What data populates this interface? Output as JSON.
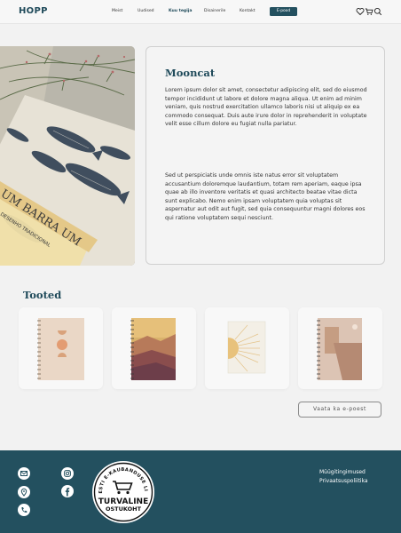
{
  "header": {
    "logo": "HOPP",
    "nav": [
      {
        "label": "Meist"
      },
      {
        "label": "Uudised"
      },
      {
        "label": "Kuu tegija"
      },
      {
        "label": "Disainerile"
      },
      {
        "label": "Kontakt"
      }
    ],
    "active_nav": "Kuu tegija",
    "eshop_label": "E-pood",
    "icons": [
      "heart-icon",
      "cart-icon",
      "search-icon"
    ]
  },
  "hero": {
    "image_alt": "sketchbooks-with-fish-illustration",
    "card_title": "Mooncat",
    "paragraph1": "Lorem ipsum dolor sit amet, consectetur adipiscing elit, sed do eiusmod tempor incididunt ut labore et dolore magna aliqua. Ut enim ad minim veniam, quis nostrud exercitation ullamco laboris nisi ut aliquip ex ea commodo consequat. Duis aute irure dolor in reprehenderit in voluptate velit esse cillum dolore eu fugiat nulla pariatur.",
    "paragraph2": "Sed ut perspiciatis unde omnis iste natus error sit voluptatem accusantium doloremque laudantium, totam rem aperiam, eaque ipsa quae ab illo inventore veritatis et quasi architecto beatae vitae dicta sunt explicabo. Nemo enim ipsam voluptatem quia voluptas sit aspernatur aut odit aut fugit, sed quia consequuntur magni dolores eos qui ratione voluptatem sequi nesciunt."
  },
  "products": {
    "title": "Tooted",
    "items": [
      {
        "name": "notebook-moon-phases"
      },
      {
        "name": "notebook-desert-sunset"
      },
      {
        "name": "notebook-sun-rays"
      },
      {
        "name": "notebook-abstract-shapes"
      }
    ],
    "more_button": "Vaata ka e-poest"
  },
  "footer": {
    "icons": [
      "email-icon",
      "location-icon",
      "phone-icon",
      "instagram-icon",
      "facebook-icon"
    ],
    "badge_text_top": "EESTI E-KAUBANDUSE LIIT",
    "badge_text_main1": "TURVALINE",
    "badge_text_main2": "OSTUKOHT",
    "links": [
      "Müügitingimused",
      "Privaatsuspoliitika"
    ]
  },
  "colors": {
    "brand": "#23505f",
    "background": "#f2f2f2"
  }
}
